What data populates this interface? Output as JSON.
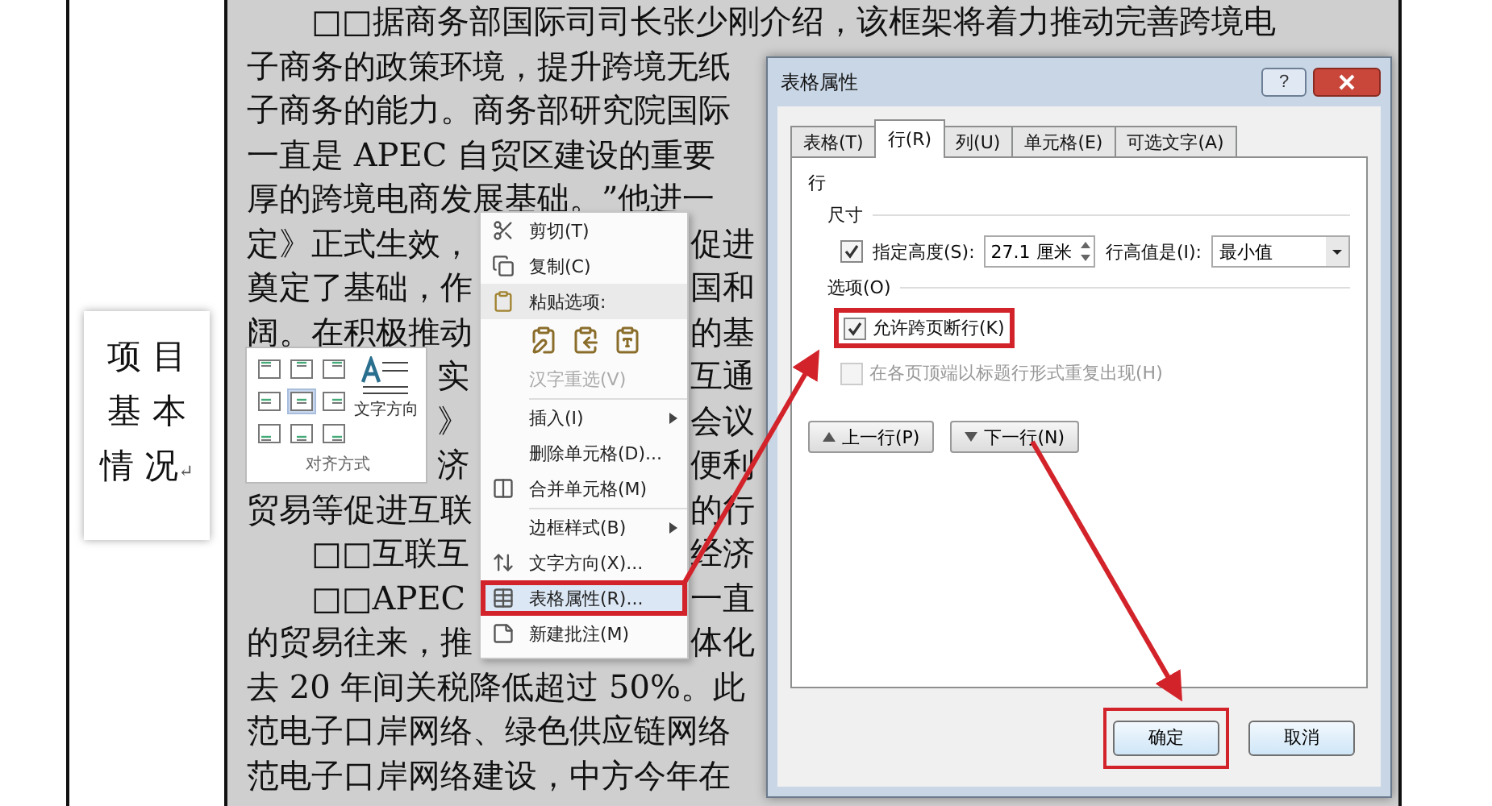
{
  "side_label": {
    "lines": [
      "项 目",
      "基 本",
      "情 况"
    ],
    "paragraph_mark": "↵"
  },
  "document": {
    "lines": [
      {
        "indent": true,
        "segments": [
          {
            "kind": "full",
            "text": "□□据商务部国际司司长张少刚介绍，该框架将着力推动完善跨境电"
          }
        ]
      },
      {
        "indent": false,
        "segments": [
          {
            "kind": "full",
            "text": "子商务的政策环境，提升跨境无纸"
          }
        ]
      },
      {
        "indent": false,
        "segments": [
          {
            "kind": "full",
            "text": "子商务的能力。商务部研究院国际"
          }
        ]
      },
      {
        "indent": false,
        "segments": [
          {
            "kind": "full",
            "text": "一直是 APEC 自贸区建设的重要"
          }
        ]
      },
      {
        "indent": false,
        "segments": [
          {
            "kind": "full",
            "text": "厚的跨境电商发展基础。”他进一"
          }
        ]
      },
      {
        "indent": false,
        "segments": [
          {
            "kind": "left",
            "text": "定》正式生效，"
          },
          {
            "kind": "after_menu",
            "text": "促进"
          }
        ]
      },
      {
        "indent": false,
        "segments": [
          {
            "kind": "left",
            "text": "奠定了基础，作"
          },
          {
            "kind": "after_menu",
            "text": "国和"
          }
        ]
      },
      {
        "indent": false,
        "segments": [
          {
            "kind": "left",
            "text": "阔。在积极推动"
          },
          {
            "kind": "after_menu",
            "text": "的基"
          }
        ]
      },
      {
        "indent": false,
        "segments": [
          {
            "kind": "after_popup",
            "text": "实"
          },
          {
            "kind": "after_menu",
            "text": "互通"
          }
        ]
      },
      {
        "indent": false,
        "segments": [
          {
            "kind": "after_popup",
            "text": "》"
          },
          {
            "kind": "after_menu",
            "text": "会议"
          }
        ]
      },
      {
        "indent": false,
        "segments": [
          {
            "kind": "after_popup",
            "text": "济"
          },
          {
            "kind": "after_menu",
            "text": "便利"
          }
        ]
      },
      {
        "indent": false,
        "segments": [
          {
            "kind": "left",
            "text": "贸易等促进互联"
          },
          {
            "kind": "after_menu",
            "text": "的行"
          }
        ]
      },
      {
        "indent": true,
        "segments": [
          {
            "kind": "left",
            "text": "□□互联互"
          },
          {
            "kind": "after_menu",
            "text": "经济"
          }
        ]
      },
      {
        "indent": true,
        "segments": [
          {
            "kind": "left",
            "text": "□□APEC"
          },
          {
            "kind": "after_menu",
            "text": "一直"
          }
        ]
      },
      {
        "indent": false,
        "segments": [
          {
            "kind": "left",
            "text": "的贸易往来，推"
          },
          {
            "kind": "after_menu",
            "text": "体化"
          }
        ]
      },
      {
        "indent": false,
        "segments": [
          {
            "kind": "full",
            "text": "去 20 年间关税降低超过 50%。此"
          }
        ]
      },
      {
        "indent": false,
        "segments": [
          {
            "kind": "full",
            "text": "范电子口岸网络、绿色供应链网络"
          }
        ]
      },
      {
        "indent": false,
        "segments": [
          {
            "kind": "full",
            "text": "范电子口岸网络建设，中方今年在"
          }
        ]
      }
    ]
  },
  "alignment_popup": {
    "cells": [
      {
        "selected": false
      },
      {
        "selected": false
      },
      {
        "selected": false
      },
      {
        "selected": false
      },
      {
        "selected": true
      },
      {
        "selected": false
      },
      {
        "selected": false
      },
      {
        "selected": false
      },
      {
        "selected": false
      }
    ],
    "direction_label": "文字方向",
    "footer": "对齐方式"
  },
  "context_menu": {
    "items": [
      {
        "kind": "cut",
        "label": "剪切(T)",
        "disabled": false,
        "annotated": false
      },
      {
        "kind": "copy",
        "label": "复制(C)",
        "disabled": false,
        "annotated": false
      },
      {
        "kind": "paste-header",
        "label": "粘贴选项:",
        "disabled": false,
        "annotated": false
      },
      {
        "kind": "paste-row"
      },
      {
        "kind": "plain",
        "label": "汉字重选(V)",
        "disabled": true,
        "annotated": false
      },
      {
        "kind": "separator"
      },
      {
        "kind": "submenu",
        "label": "插入(I)",
        "disabled": false,
        "annotated": false
      },
      {
        "kind": "plain",
        "label": "删除单元格(D)...",
        "disabled": false,
        "annotated": false
      },
      {
        "kind": "merge",
        "label": "合并单元格(M)",
        "disabled": false,
        "annotated": false
      },
      {
        "kind": "separator"
      },
      {
        "kind": "submenu",
        "label": "边框样式(B)",
        "disabled": false,
        "annotated": false
      },
      {
        "kind": "direction",
        "label": "文字方向(X)...",
        "disabled": false,
        "annotated": false
      },
      {
        "kind": "properties",
        "label": "表格属性(R)...",
        "disabled": false,
        "annotated": true
      },
      {
        "kind": "comment",
        "label": "新建批注(M)",
        "disabled": false,
        "annotated": false
      }
    ]
  },
  "dialog": {
    "title": "表格属性",
    "help": "?",
    "tabs": [
      {
        "label": "表格(T)",
        "selected": false
      },
      {
        "label": "行(R)",
        "selected": true
      },
      {
        "label": "列(U)",
        "selected": false
      },
      {
        "label": "单元格(E)",
        "selected": false
      },
      {
        "label": "可选文字(A)",
        "selected": false
      }
    ],
    "section": "行",
    "size_group": "尺寸",
    "height": {
      "checked": true,
      "label": "指定高度(S):",
      "value": "27.1 厘米"
    },
    "row_height_label": "行高值是(I):",
    "row_height_value": "最小值",
    "options_group": "选项(O)",
    "options": [
      {
        "label": "允许跨页断行(K)",
        "checked": true,
        "disabled": false,
        "annotated": true
      },
      {
        "label": "在各页顶端以标题行形式重复出现(H)",
        "checked": false,
        "disabled": true,
        "annotated": false
      }
    ],
    "nav_buttons": [
      {
        "kind": "up",
        "label": "上一行(P)"
      },
      {
        "kind": "down",
        "label": "下一行(N)"
      }
    ],
    "buttons": [
      {
        "label": "确定",
        "annotated": true
      },
      {
        "label": "取消",
        "annotated": false
      }
    ]
  }
}
